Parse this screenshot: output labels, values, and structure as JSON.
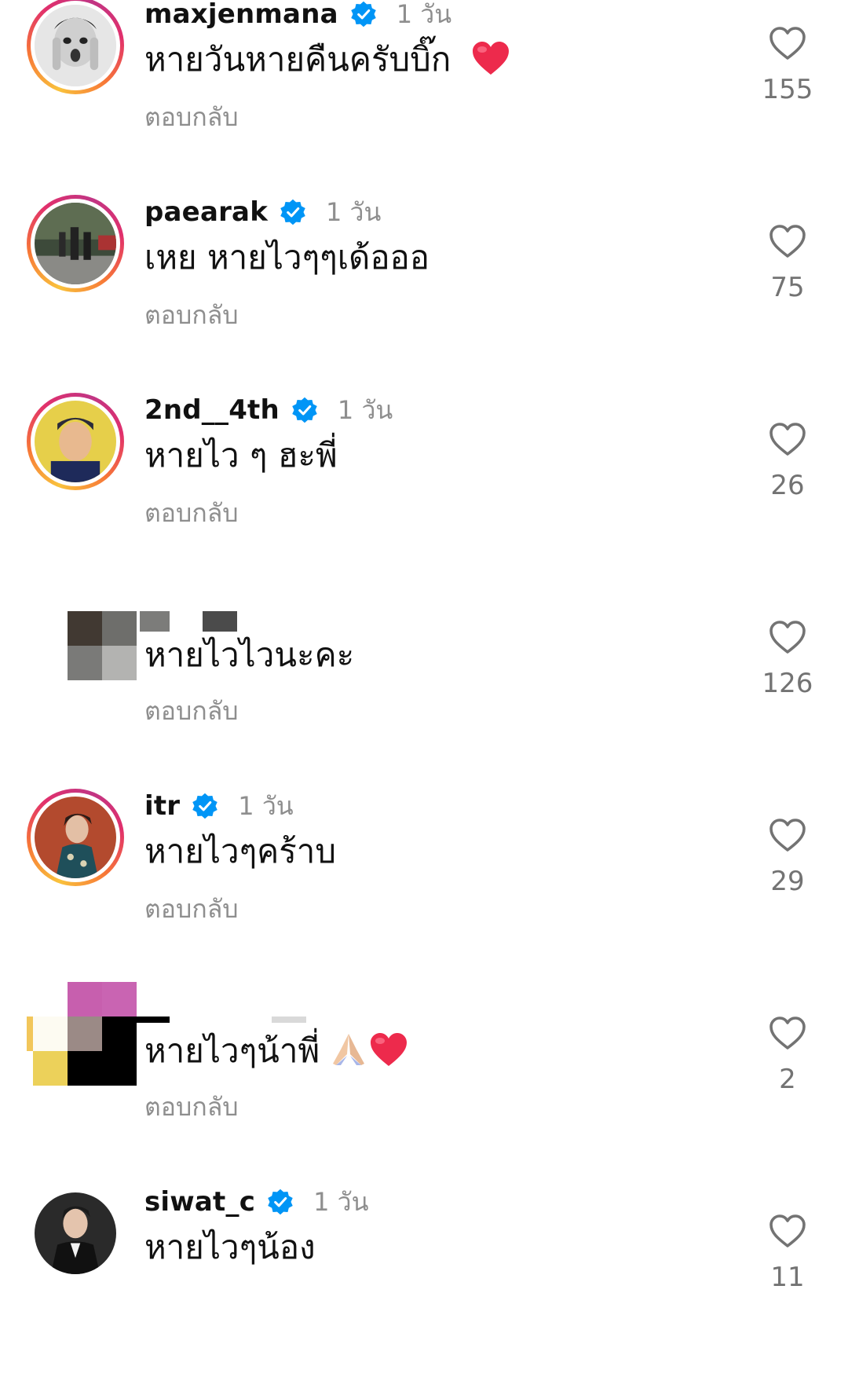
{
  "comments": [
    {
      "username": "maxjenmana",
      "time": "1 วัน",
      "text": "หายวันหายคืนครับบิ๊ก",
      "reply": "ตอบกลับ",
      "likes": "155",
      "avatar_icon": "avatar-maxjenmana",
      "emoji": "red-heart"
    },
    {
      "username": "paearak",
      "time": "1 วัน",
      "text": "เหย หายไวๆๆเด้อออ",
      "reply": "ตอบกลับ",
      "likes": "75",
      "avatar_icon": "avatar-paearak"
    },
    {
      "username": "2nd__4th",
      "time": "1 วัน",
      "text": "หายไว ๆ ฮะพี่",
      "reply": "ตอบกลับ",
      "likes": "26",
      "avatar_icon": "avatar-2nd-4th"
    },
    {
      "username": "",
      "time": "",
      "text": "หายไวไวนะคะ",
      "reply": "ตอบกลับ",
      "likes": "126",
      "avatar_icon": "avatar-censored"
    },
    {
      "username": "itr",
      "time": "1 วัน",
      "text": "หายไวๆคร้าบ",
      "reply": "ตอบกลับ",
      "likes": "29",
      "avatar_icon": "avatar-itr"
    },
    {
      "username": "",
      "time": "",
      "text": "หายไวๆน้าพี่",
      "reply": "ตอบกลับ",
      "likes": "2",
      "avatar_icon": "avatar-censored-2",
      "emoji": "folded-hands red-heart"
    },
    {
      "username": "siwat_c",
      "time": "1 วัน",
      "text": "หายไวๆน้อง",
      "reply": "",
      "likes": "11",
      "avatar_icon": "avatar-siwat-c"
    }
  ],
  "colors": {
    "verified": "#0095f6",
    "meta": "#8e8e8e",
    "heart_emoji": "#ed2a4c"
  }
}
